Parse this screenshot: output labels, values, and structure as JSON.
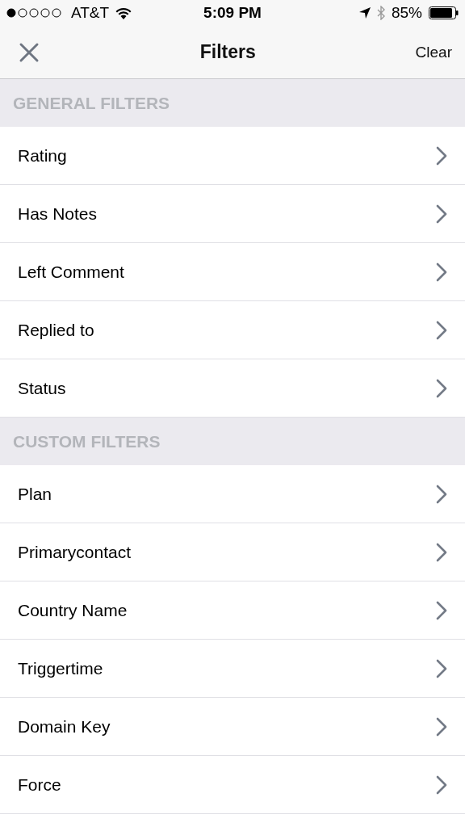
{
  "status_bar": {
    "carrier": "AT&T",
    "time": "5:09 PM",
    "battery": "85%"
  },
  "nav": {
    "title": "Filters",
    "action": "Clear"
  },
  "sections": [
    {
      "title": "GENERAL FILTERS",
      "items": [
        "Rating",
        "Has Notes",
        "Left Comment",
        "Replied to",
        "Status"
      ]
    },
    {
      "title": "CUSTOM FILTERS",
      "items": [
        "Plan",
        "Primarycontact",
        "Country Name",
        "Triggertime",
        "Domain Key",
        "Force"
      ]
    }
  ]
}
